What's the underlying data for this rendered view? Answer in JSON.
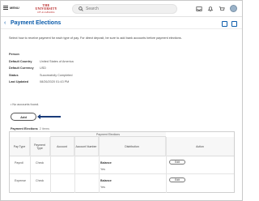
{
  "topbar": {
    "menu_label": "MENU",
    "logo_line1": "THE UNIVERSITY",
    "logo_line2": "OF ALABAMA",
    "search_placeholder": "Search"
  },
  "header": {
    "title": "Payment Elections"
  },
  "intro_text": "Select how to receive payment for each type of pay. For direct deposit, be sure to add bank accounts before payment elections.",
  "fields": [
    {
      "label": "Person",
      "value": ""
    },
    {
      "label": "Default Country",
      "value": "United States of America"
    },
    {
      "label": "Default Currency",
      "value": "USD"
    },
    {
      "label": "Status",
      "value": "Successfully Completed"
    },
    {
      "label": "Last Updated",
      "value": "08/26/2020 01:43 PM"
    }
  ],
  "no_accounts": "No accounts found.",
  "add_button": "Add",
  "table": {
    "caption": "Payment Elections",
    "count": "2 items",
    "group_header": "Payment Elections",
    "columns": [
      "Pay Type",
      "Payment Type",
      "Account",
      "Account Number",
      "Distribution",
      "Action"
    ],
    "rows": [
      {
        "pay_type": "Payroll",
        "payment_type": "Check",
        "account": "",
        "account_number": "",
        "dist_label": "Balance",
        "dist_value": "Yes",
        "action": "Edit"
      },
      {
        "pay_type": "Expense",
        "payment_type": "Check",
        "account": "",
        "account_number": "",
        "dist_label": "Balance",
        "dist_value": "Yes",
        "action": "Edit"
      }
    ]
  }
}
